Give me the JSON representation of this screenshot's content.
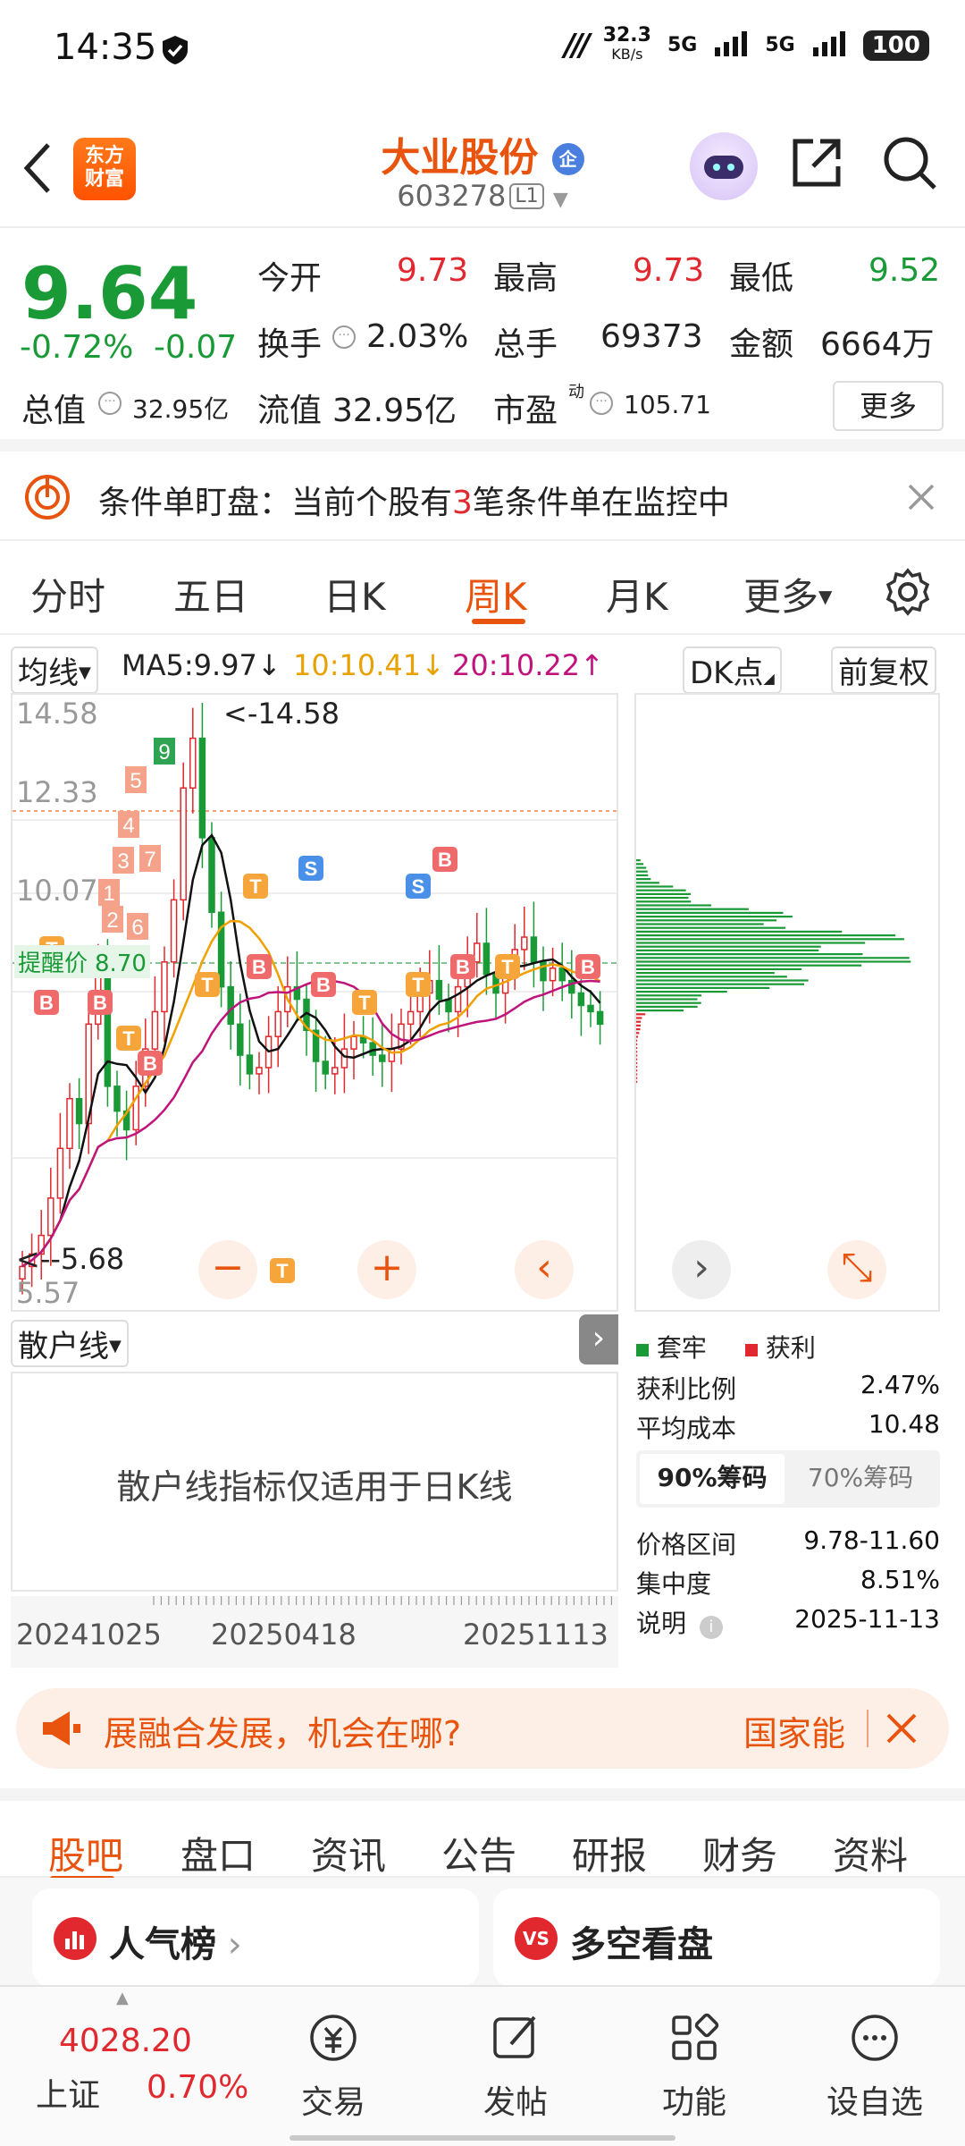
{
  "status_bar": {
    "time": "14:35",
    "net_speed": "32.3",
    "net_unit": "KB/s",
    "sim1": "5G",
    "sim2": "5G",
    "battery": "100"
  },
  "header": {
    "logo_top": "东方",
    "logo_bottom": "财富",
    "name": "大业股份",
    "name_badge": "企",
    "code": "603278",
    "level": "L1"
  },
  "quote": {
    "price": "9.64",
    "change_pct": "-0.72%",
    "change": "-0.07",
    "open_label": "今开",
    "open": "9.73",
    "high_label": "最高",
    "high": "9.73",
    "low_label": "最低",
    "low": "9.52",
    "turnover_label": "换手",
    "turnover": "2.03%",
    "volume_label": "总手",
    "volume": "69373",
    "amount_label": "金额",
    "amount": "6664万",
    "mcap_label": "总值",
    "mcap": "32.95亿",
    "float_label": "流值",
    "float": "32.95亿",
    "pe_label": "市盈",
    "pe_sup": "动",
    "pe": "105.71",
    "more": "更多"
  },
  "condition_bar": {
    "prefix": "条件单盯盘：当前个股有",
    "count": "3",
    "suffix": "笔条件单在监控中"
  },
  "kline_tabs": [
    "分时",
    "五日",
    "日K",
    "周K",
    "月K",
    "更多"
  ],
  "active_tab": "周K",
  "indicator": {
    "ma_select": "均线",
    "ma5": "MA5:9.97",
    "ma10": "10:10.41",
    "ma20": "20:10.22",
    "dk": "DK点",
    "adjust": "前复权"
  },
  "kchart": {
    "price_labels": [
      "14.58",
      "12.33",
      "10.07",
      "5.57"
    ],
    "max_marker": "<-14.58",
    "min_marker": "<--5.68",
    "alert_label": "提醒价",
    "alert_value": "8.70",
    "marker_numbers": [
      "1",
      "2",
      "3",
      "4",
      "5",
      "6",
      "7",
      "9"
    ],
    "label_b": "B",
    "label_s": "S",
    "label_t": "T",
    "minus": "−",
    "plus": "+",
    "prev": "‹",
    "next": "›",
    "expand": "⤡"
  },
  "sanhu": {
    "select": "散户线",
    "notice": "散户线指标仅适用于日K线"
  },
  "xaxis": [
    "20241025",
    "20250418",
    "20251113"
  ],
  "distribution": {
    "legend_trapped": "套牢",
    "legend_profit": "获利",
    "profit_ratio_label": "获利比例",
    "profit_ratio": "2.47%",
    "avg_cost_label": "平均成本",
    "avg_cost": "10.48",
    "tab90": "90%筹码",
    "tab70": "70%筹码",
    "range_label": "价格区间",
    "range": "9.78-11.60",
    "concentration_label": "集中度",
    "concentration": "8.51%",
    "note_label": "说明",
    "note_date": "2025-11-13"
  },
  "banner": {
    "text": "展融合发展，机会在哪?",
    "tag": "国家能"
  },
  "bottom_tabs": [
    "股吧",
    "盘口",
    "资讯",
    "公告",
    "研报",
    "财务",
    "资料"
  ],
  "active_bottom_tab": "股吧",
  "cards": {
    "left": "人气榜",
    "right": "多空看盘"
  },
  "bottom_nav": {
    "index_value": "4028.20",
    "index_name": "上证",
    "index_change": "0.70%",
    "trade": "交易",
    "post": "发帖",
    "func": "功能",
    "watch": "设自选"
  },
  "colors": {
    "accent": "#e8540e",
    "up": "#e0282e",
    "down": "#1a9a37"
  }
}
